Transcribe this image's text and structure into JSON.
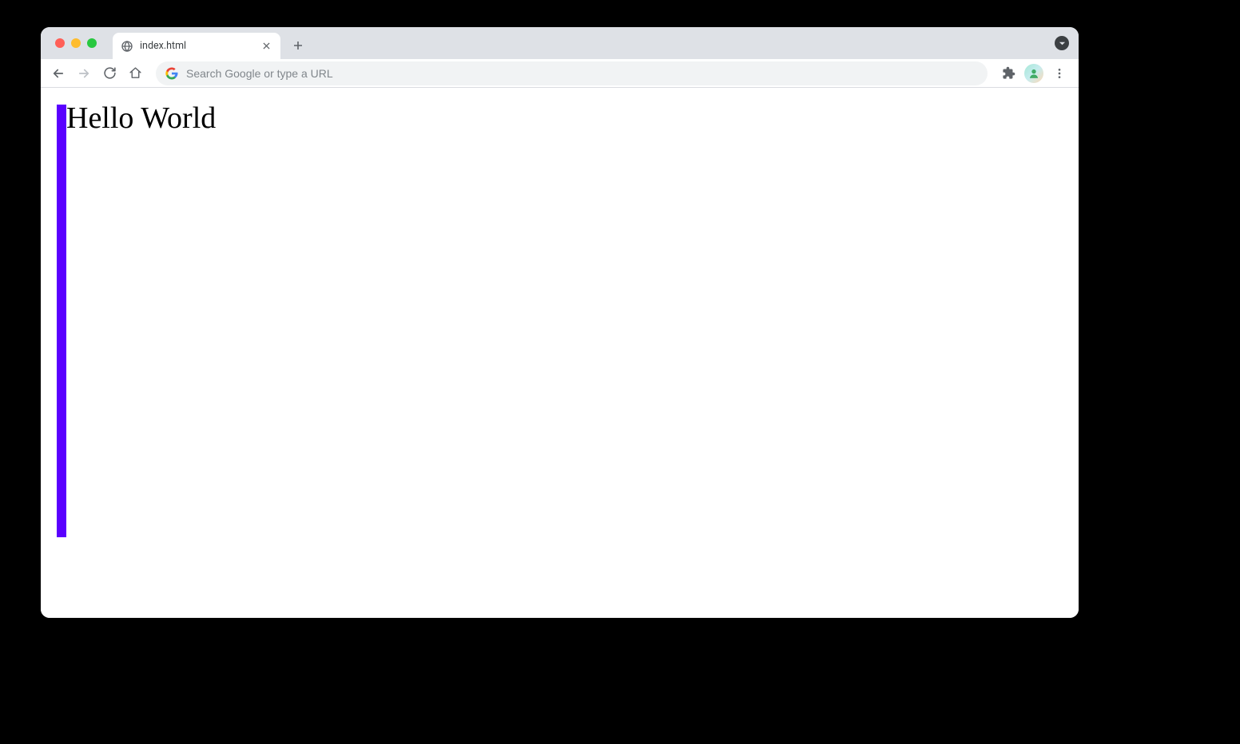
{
  "browser": {
    "tab_title": "index.html",
    "omnibox_placeholder": "Search Google or type a URL"
  },
  "page": {
    "heading": "Hello World",
    "accent_color": "#5a00ff"
  }
}
